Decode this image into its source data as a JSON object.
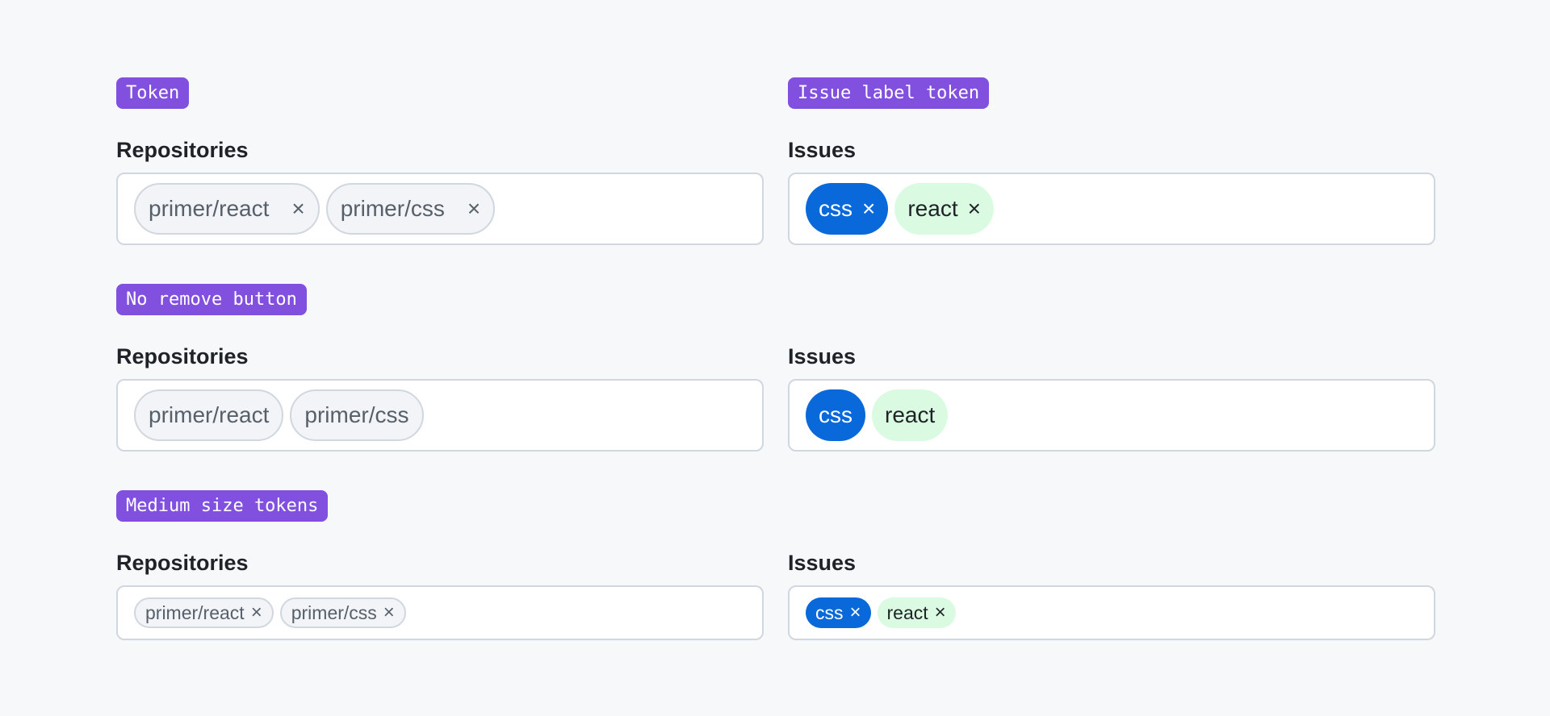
{
  "sections": [
    {
      "badge": "Token",
      "left": {
        "label": "Repositories",
        "tokens": [
          "primer/react",
          "primer/css"
        ]
      },
      "right": {
        "label": "Issues",
        "tokens": [
          "css",
          "react"
        ]
      }
    },
    {
      "badge": "No remove button",
      "left": {
        "label": "Repositories",
        "tokens": [
          "primer/react",
          "primer/css"
        ]
      },
      "right": {
        "label": "Issues",
        "tokens": [
          "css",
          "react"
        ]
      }
    },
    {
      "badge": "Medium size tokens",
      "left": {
        "label": "Repositories",
        "tokens": [
          "primer/react",
          "primer/css"
        ]
      },
      "right": {
        "label": "Issues",
        "tokens": [
          "css",
          "react"
        ]
      }
    }
  ],
  "badge2": "Issue label token",
  "remove_icon": "×",
  "colors": {
    "badge": "#8250df",
    "css_label": "#0969da",
    "react_label": "#dafbe1"
  }
}
